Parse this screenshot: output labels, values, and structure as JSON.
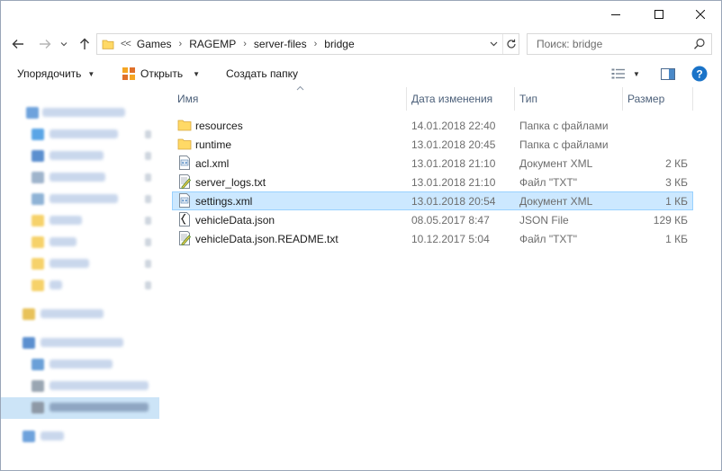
{
  "window": {
    "controls": {
      "minimize_icon": "minimize-icon",
      "maximize_icon": "maximize-icon",
      "close_icon": "close-icon"
    }
  },
  "address_bar": {
    "overflow": "<<",
    "crumbs": [
      "Games",
      "RAGEMP",
      "server-files",
      "bridge"
    ]
  },
  "search": {
    "placeholder": "Поиск: bridge"
  },
  "commands": {
    "organize": "Упорядочить",
    "open": "Открыть",
    "new_folder": "Создать папку"
  },
  "columns": {
    "name": "Имя",
    "date": "Дата изменения",
    "type": "Тип",
    "size": "Размер"
  },
  "files": [
    {
      "name": "resources",
      "date": "14.01.2018 22:40",
      "type": "Папка с файлами",
      "size": "",
      "icon": "folder-icon"
    },
    {
      "name": "runtime",
      "date": "13.01.2018 20:45",
      "type": "Папка с файлами",
      "size": "",
      "icon": "folder-icon"
    },
    {
      "name": "acl.xml",
      "date": "13.01.2018 21:10",
      "type": "Документ XML",
      "size": "2 КБ",
      "icon": "xml-file-icon"
    },
    {
      "name": "server_logs.txt",
      "date": "13.01.2018 21:10",
      "type": "Файл \"TXT\"",
      "size": "3 КБ",
      "icon": "txt-file-icon"
    },
    {
      "name": "settings.xml",
      "date": "13.01.2018 20:54",
      "type": "Документ XML",
      "size": "1 КБ",
      "icon": "xml-file-icon",
      "selected": true
    },
    {
      "name": "vehicleData.json",
      "date": "08.05.2017 8:47",
      "type": "JSON File",
      "size": "129 КБ",
      "icon": "json-file-icon"
    },
    {
      "name": "vehicleData.json.README.txt",
      "date": "10.12.2017 5:04",
      "type": "Файл \"TXT\"",
      "size": "1 КБ",
      "icon": "txt-file-icon"
    }
  ],
  "colors": {
    "selection_bg": "#cce8ff",
    "selection_border": "#99d1ff",
    "header_text": "#4c607a",
    "folder_yellow": "#ffd966",
    "help_blue": "#1a73c8"
  }
}
